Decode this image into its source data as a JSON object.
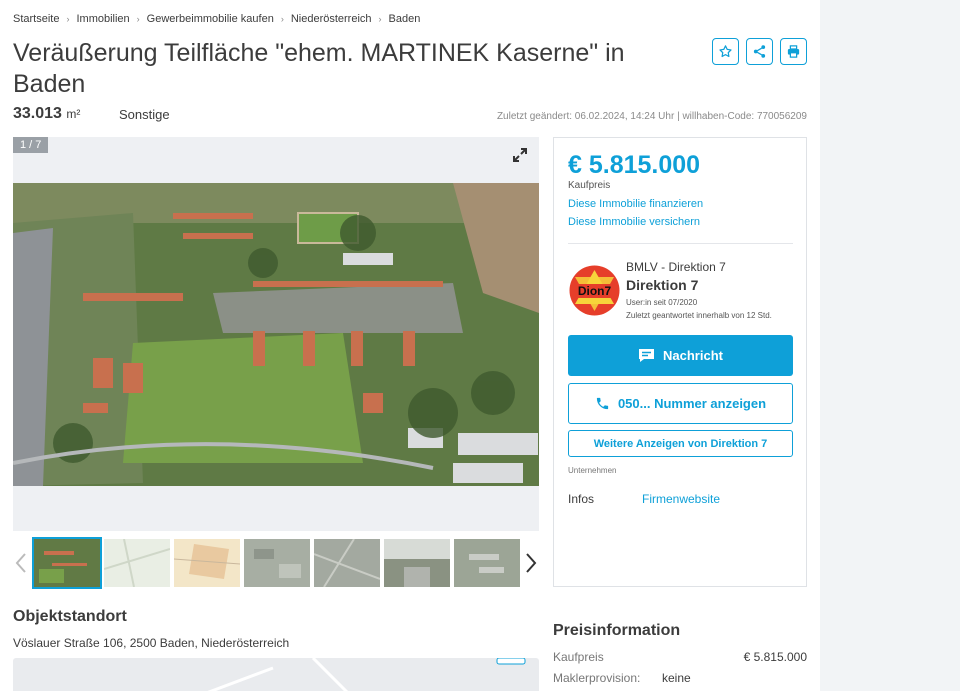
{
  "breadcrumb": [
    "Startseite",
    "Immobilien",
    "Gewerbeimmobilie kaufen",
    "Niederösterreich",
    "Baden"
  ],
  "listing": {
    "title": "Veräußerung Teilfläche \"ehem. MARTINEK Kaserne\" in Baden",
    "area": "33.013",
    "area_unit": "m²",
    "type": "Sonstige",
    "meta": "Zuletzt geändert: 06.02.2024, 14:24 Uhr | willhaben-Code: 770056209"
  },
  "gallery": {
    "counter": "1 / 7",
    "thumbnail_count": 7,
    "active_thumbnail": 1
  },
  "price_card": {
    "price": "€ 5.815.000",
    "price_label": "Kaufpreis",
    "finance_link": "Diese Immobilie finanzieren",
    "insure_link": "Diese Immobilie versichern",
    "company_sub": "BMLV - Direktion 7",
    "company_name": "Direktion 7",
    "logo_text": "Dion7",
    "member_since": "User:in seit 07/2020",
    "response_time": "Zuletzt geantwortet innerhalb von 12 Std.",
    "message_button": "Nachricht",
    "phone_button": "050... Nummer anzeigen",
    "more_ads_button": "Weitere Anzeigen von Direktion 7",
    "company_type": "Unternehmen",
    "infos_label": "Infos",
    "website_link": "Firmenwebsite"
  },
  "location": {
    "title": "Objektstandort",
    "address": "Vöslauer Straße 106, 2500 Baden, Niederösterreich"
  },
  "price_info": {
    "title": "Preisinformation",
    "purchase_label": "Kaufpreis",
    "purchase_value": "€ 5.815.000",
    "commission_label": "Maklerprovision:",
    "commission_value": "keine"
  },
  "colors": {
    "accent": "#0ea0d8",
    "text": "#3c3c3c",
    "muted": "#8a8a8a",
    "background": "#f2f4f6"
  },
  "icons": [
    "star-icon",
    "share-icon",
    "print-icon",
    "expand-icon",
    "chevron-left-icon",
    "chevron-right-icon",
    "chat-icon",
    "phone-icon"
  ]
}
